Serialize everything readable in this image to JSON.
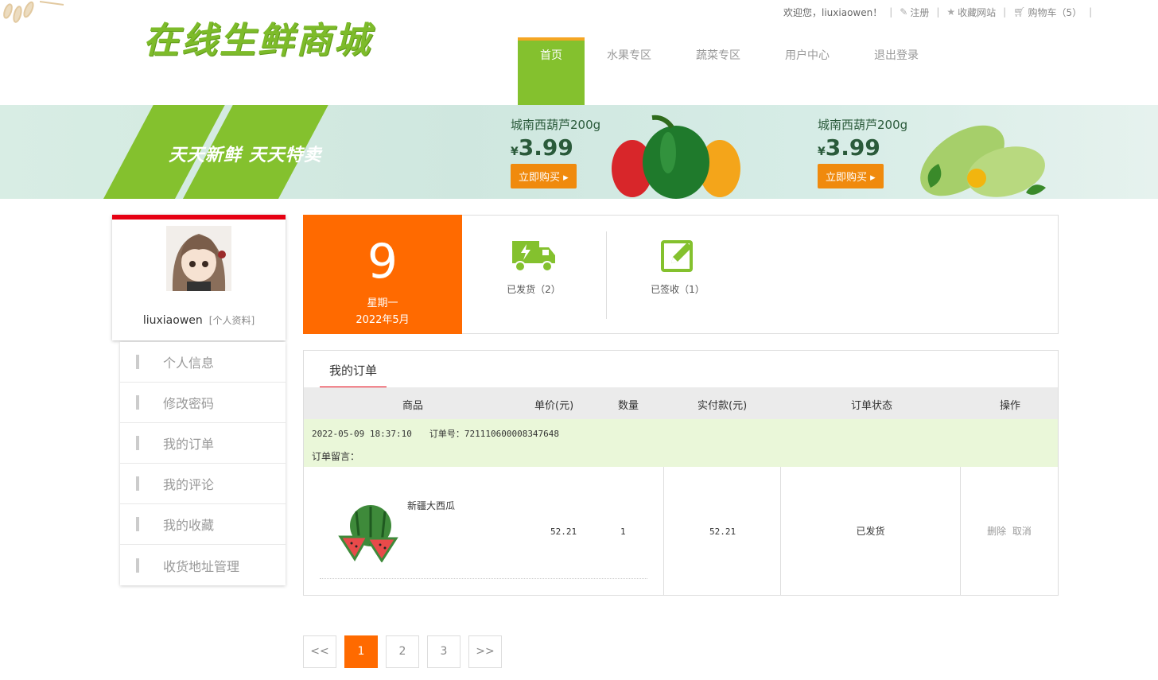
{
  "logo": "在线生鲜商城",
  "topbar": {
    "welcome": "欢迎您，liuxiaowen！",
    "register": "注册",
    "favorite": "收藏网站",
    "cart": "购物车（5）"
  },
  "nav": [
    {
      "label": "首页",
      "active": true
    },
    {
      "label": "水果专区"
    },
    {
      "label": "蔬菜专区"
    },
    {
      "label": "用户中心"
    },
    {
      "label": "退出登录"
    }
  ],
  "banner": {
    "slogan": "天天新鲜  天天特卖",
    "promos": [
      {
        "name": "城南西葫芦200g",
        "currency": "¥",
        "price": "3.99",
        "button": "立即购买 ▸"
      },
      {
        "name": "城南西葫芦200g",
        "currency": "¥",
        "price": "3.99",
        "button": "立即购买 ▸"
      }
    ]
  },
  "profile": {
    "username": "liuxiaowen",
    "link": "[个人资料]"
  },
  "menu": [
    "个人信息",
    "修改密码",
    "我的订单",
    "我的评论",
    "我的收藏",
    "收货地址管理"
  ],
  "date": {
    "day": "9",
    "weekday": "星期一",
    "yearmonth": "2022年5月"
  },
  "stats": {
    "shipped": "已发货（2）",
    "received": "已签收（1）"
  },
  "orders": {
    "tab": "我的订单",
    "headers": {
      "product": "商品",
      "unit_price": "单价(元)",
      "quantity": "数量",
      "paid": "实付款(元)",
      "status": "订单状态",
      "action": "操作"
    },
    "order": {
      "time": "2022-05-09 18:37:10",
      "number": "订单号：721110600008347648",
      "note": "订单留言：",
      "product_name": "新疆大西瓜",
      "unit_price": "52.21",
      "quantity": "1",
      "paid": "52.21",
      "status": "已发货",
      "delete": "删除",
      "cancel": "取消"
    }
  },
  "pagination": {
    "prev": "<<",
    "pages": [
      "1",
      "2",
      "3"
    ],
    "current": "1",
    "next": ">>"
  },
  "colors": {
    "brand_green": "#84c12e",
    "accent_orange": "#ff6a00",
    "nav_accent": "#f5a623",
    "red": "#e60012"
  }
}
